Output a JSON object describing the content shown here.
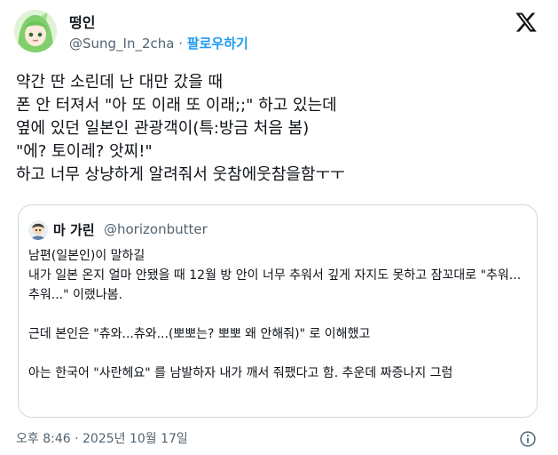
{
  "author": {
    "name": "떵인",
    "handle": "@Sung_In_2cha",
    "separator": " · ",
    "follow_label": "팔로우하기"
  },
  "post": {
    "text": "약간 딴 소린데 난 대만 갔을 때\n폰 안 터져서 \"아 또 이래 또 이래;;\" 하고 있는데\n옆에 있던 일본인 관광객이(특:방금 처음 봄)\n\"에? 토이레? 앗찌!\"\n하고 너무 상냥하게 알려줘서 웃참에웃참을함ㅜㅜ"
  },
  "quote": {
    "name": "마 가린",
    "handle": "@horizonbutter",
    "text": "남편(일본인)이 말하길\n내가 일본 온지 얼마 안됐을 때 12월 방 안이 너무 추워서 깊게 자지도 못하고 잠꼬대로 \"추워...추워...\" 이랬나봄.\n\n근데 본인은 \"츄와...츄와...(뽀뽀는? 뽀뽀 왜 안해줘)\" 로 이해했고\n\n아는 한국어 \"사란헤요\" 를 남발하자 내가 깨서 줘팼다고 함. 추운데 짜증나지 그럼"
  },
  "footer": {
    "timestamp": "오후 8:46 · 2025년 10월 17일"
  },
  "icons": {
    "logo": "x-logo-icon",
    "info": "info-icon"
  },
  "colors": {
    "accent": "#1d9bf0",
    "secondary_text": "#536471",
    "border": "#cfd9de"
  }
}
